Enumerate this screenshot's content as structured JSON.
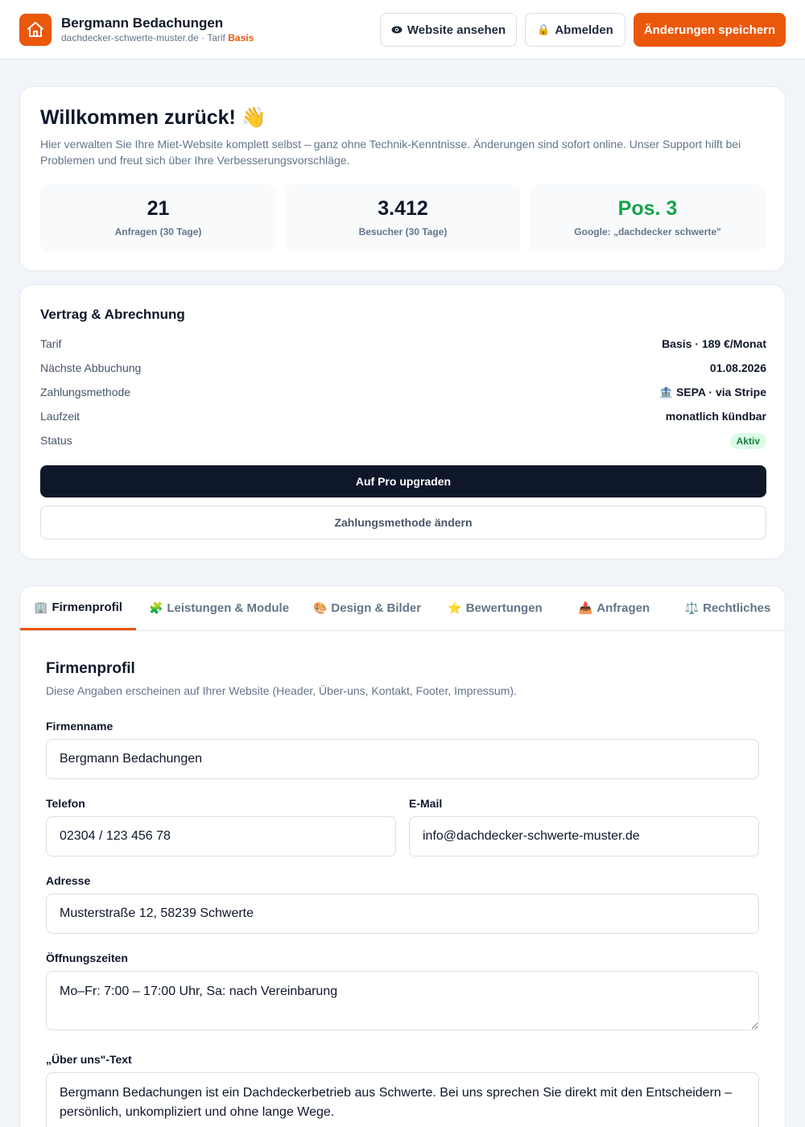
{
  "header": {
    "company": "Bergmann Bedachungen",
    "domain": "dachdecker-schwerte-muster.de",
    "tariff_prefix": "· Tarif",
    "tariff": "Basis",
    "view_site": "Website ansehen",
    "logout": "Abmelden",
    "save": "Änderungen speichern",
    "icons": {
      "logo": "house-icon",
      "view": "eye-icon",
      "logout": "lock-icon"
    },
    "colors": {
      "accent": "#ea580c"
    }
  },
  "welcome": {
    "title": "Willkommen zurück! 👋",
    "text": "Hier verwalten Sie Ihre Miet-Website komplett selbst – ganz ohne Technik-Kenntnisse. Änderungen sind sofort online. Unser Support hilft bei Problemen und freut sich über Ihre Verbesserungsvorschläge.",
    "stats": [
      {
        "value": "21",
        "label": "Anfragen (30 Tage)"
      },
      {
        "value": "3.412",
        "label": "Besucher (30 Tage)"
      },
      {
        "value": "Pos. 3",
        "label": "Google: „dachdecker schwerte\"",
        "color": "#16a34a"
      }
    ]
  },
  "contract": {
    "title": "Vertrag & Abrechnung",
    "rows": [
      {
        "label": "Tarif",
        "value": "Basis · 189 €/Monat"
      },
      {
        "label": "Nächste Abbuchung",
        "value": "01.08.2026"
      },
      {
        "label": "Zahlungsmethode",
        "value": "🏦 SEPA · via Stripe"
      },
      {
        "label": "Laufzeit",
        "value": "monatlich kündbar"
      },
      {
        "label": "Status",
        "value": "Aktiv"
      }
    ],
    "upgrade": "Auf Pro upgraden",
    "change_payment": "Zahlungsmethode ändern"
  },
  "tabs": [
    {
      "icon": "🏢",
      "label": "Firmenprofil"
    },
    {
      "icon": "🧩",
      "label": "Leistungen & Module"
    },
    {
      "icon": "🎨",
      "label": "Design & Bilder"
    },
    {
      "icon": "⭐",
      "label": "Bewertungen"
    },
    {
      "icon": "📥",
      "label": "Anfragen"
    },
    {
      "icon": "⚖️",
      "label": "Rechtliches"
    }
  ],
  "profile": {
    "title": "Firmenprofil",
    "desc": "Diese Angaben erscheinen auf Ihrer Website (Header, Über-uns, Kontakt, Footer, Impressum).",
    "company_label": "Firmenname",
    "company_value": "Bergmann Bedachungen",
    "phone_label": "Telefon",
    "phone_value": "02304 / 123 456 78",
    "email_label": "E-Mail",
    "email_value": "info@dachdecker-schwerte-muster.de",
    "address_label": "Adresse",
    "address_value": "Musterstraße 12, 58239 Schwerte",
    "hours_label": "Öffnungszeiten",
    "hours_value": "Mo–Fr: 7:00 – 17:00 Uhr, Sa: nach Vereinbarung",
    "about_label": "„Über uns\"-Text",
    "about_value": "Bergmann Bedachungen ist ein Dachdeckerbetrieb aus Schwerte. Bei uns sprechen Sie direkt mit den Entscheidern – persönlich, unkompliziert und ohne lange Wege."
  }
}
